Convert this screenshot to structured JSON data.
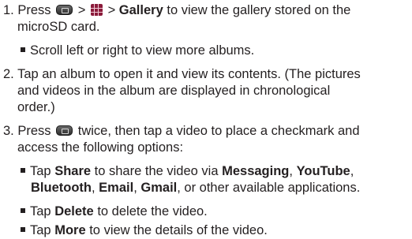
{
  "step1": {
    "num": "1.",
    "press": "Press",
    "gt1": ">",
    "gt2": ">",
    "gallery": "Gallery",
    "rest": "to view the gallery stored on the",
    "line2": "microSD card.",
    "bullet": "Scroll left or right to view more albums."
  },
  "step2": {
    "num": "2.",
    "line1": "Tap an album to open it and view its contents. (The pictures",
    "line2": "and videos in the album are displayed in chronological",
    "line3": "order.)"
  },
  "step3": {
    "num": "3.",
    "press": "Press",
    "rest": "twice, then tap a video to place a checkmark and",
    "line2": "access the following options:",
    "share": {
      "tap": "Tap",
      "share": "Share",
      "t1": "to share the video via",
      "messaging": "Messaging",
      "comma1": ",",
      "youtube": "YouTube",
      "comma2": ",",
      "bluetooth": "Bluetooth",
      "comma3": ",",
      "email": "Email",
      "comma4": ",",
      "gmail": "Gmail",
      "t2": ", or other available applications."
    },
    "delete": {
      "tap": "Tap",
      "label": "Delete",
      "rest": "to delete the video."
    },
    "more": {
      "tap": "Tap",
      "label": "More",
      "rest": "to view the details of the video."
    }
  },
  "icons": {
    "menu_key": "menu-key-icon",
    "apps": "applications-icon"
  }
}
